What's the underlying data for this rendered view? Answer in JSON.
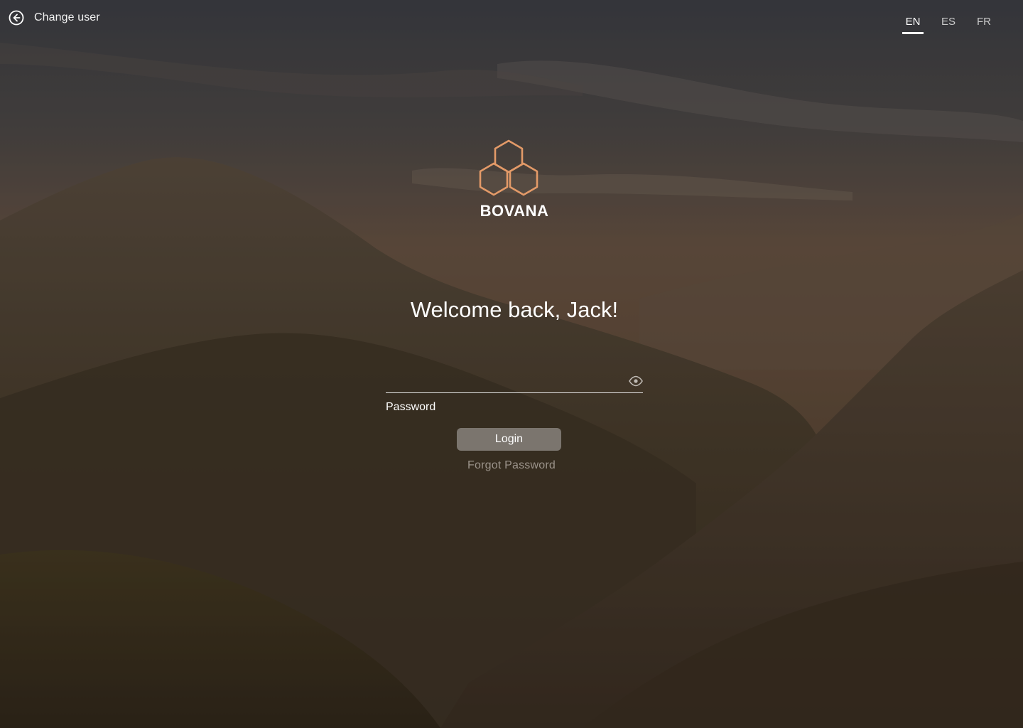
{
  "header": {
    "change_user_label": "Change user",
    "back_icon": "arrow-left-circle-icon"
  },
  "languages": [
    {
      "code": "EN",
      "active": true
    },
    {
      "code": "ES",
      "active": false
    },
    {
      "code": "FR",
      "active": false
    }
  ],
  "brand": {
    "name": "BOVANA",
    "logo_icon": "hexagon-cluster-icon",
    "logo_color": "#e39a68"
  },
  "login": {
    "welcome_text": "Welcome back,  Jack!",
    "password_label": "Password",
    "password_value": "",
    "password_visibility_icon": "eye-icon",
    "login_button_label": "Login",
    "forgot_password_label": "Forgot Password"
  },
  "colors": {
    "text_primary": "#ffffff",
    "link_muted": "#9b938a",
    "button_bg": "#96928c"
  }
}
